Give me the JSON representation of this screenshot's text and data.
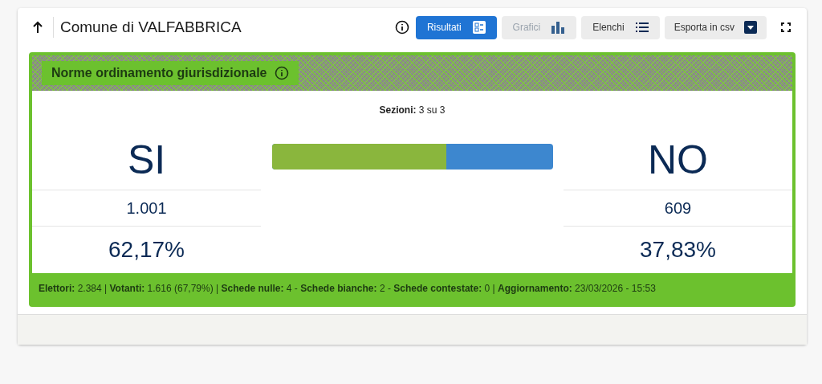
{
  "header": {
    "title": "Comune di VALFABBRICA"
  },
  "views": [
    {
      "label": "Risultati",
      "kind": "list",
      "selected": true,
      "disabled": false
    },
    {
      "label": "Grafici",
      "kind": "bars",
      "selected": false,
      "disabled": true
    },
    {
      "label": "Elenchi",
      "kind": "lines",
      "selected": false,
      "disabled": false
    }
  ],
  "export_button": {
    "label": "Esporta in csv"
  },
  "referendum": {
    "title": "Norme ordinamento giurisdizionale",
    "sections": "**Sezioni:** 3 su 3",
    "yes": {
      "label": "SI",
      "votes": "1.001",
      "percent": "62,17%"
    },
    "no": {
      "label": "NO",
      "votes": "609",
      "percent": "37,83%"
    },
    "bar": {
      "level": 0.6217
    },
    "summary": "**Elettori:** 2.384 | **Votanti:** 1.616 (67,79%) | **Schede nulle:** 4 - **Schede bianche:** 2 - **Schede contestate:** 0 | **Aggiornamento:** 23/03/2026 - 15:53"
  }
}
